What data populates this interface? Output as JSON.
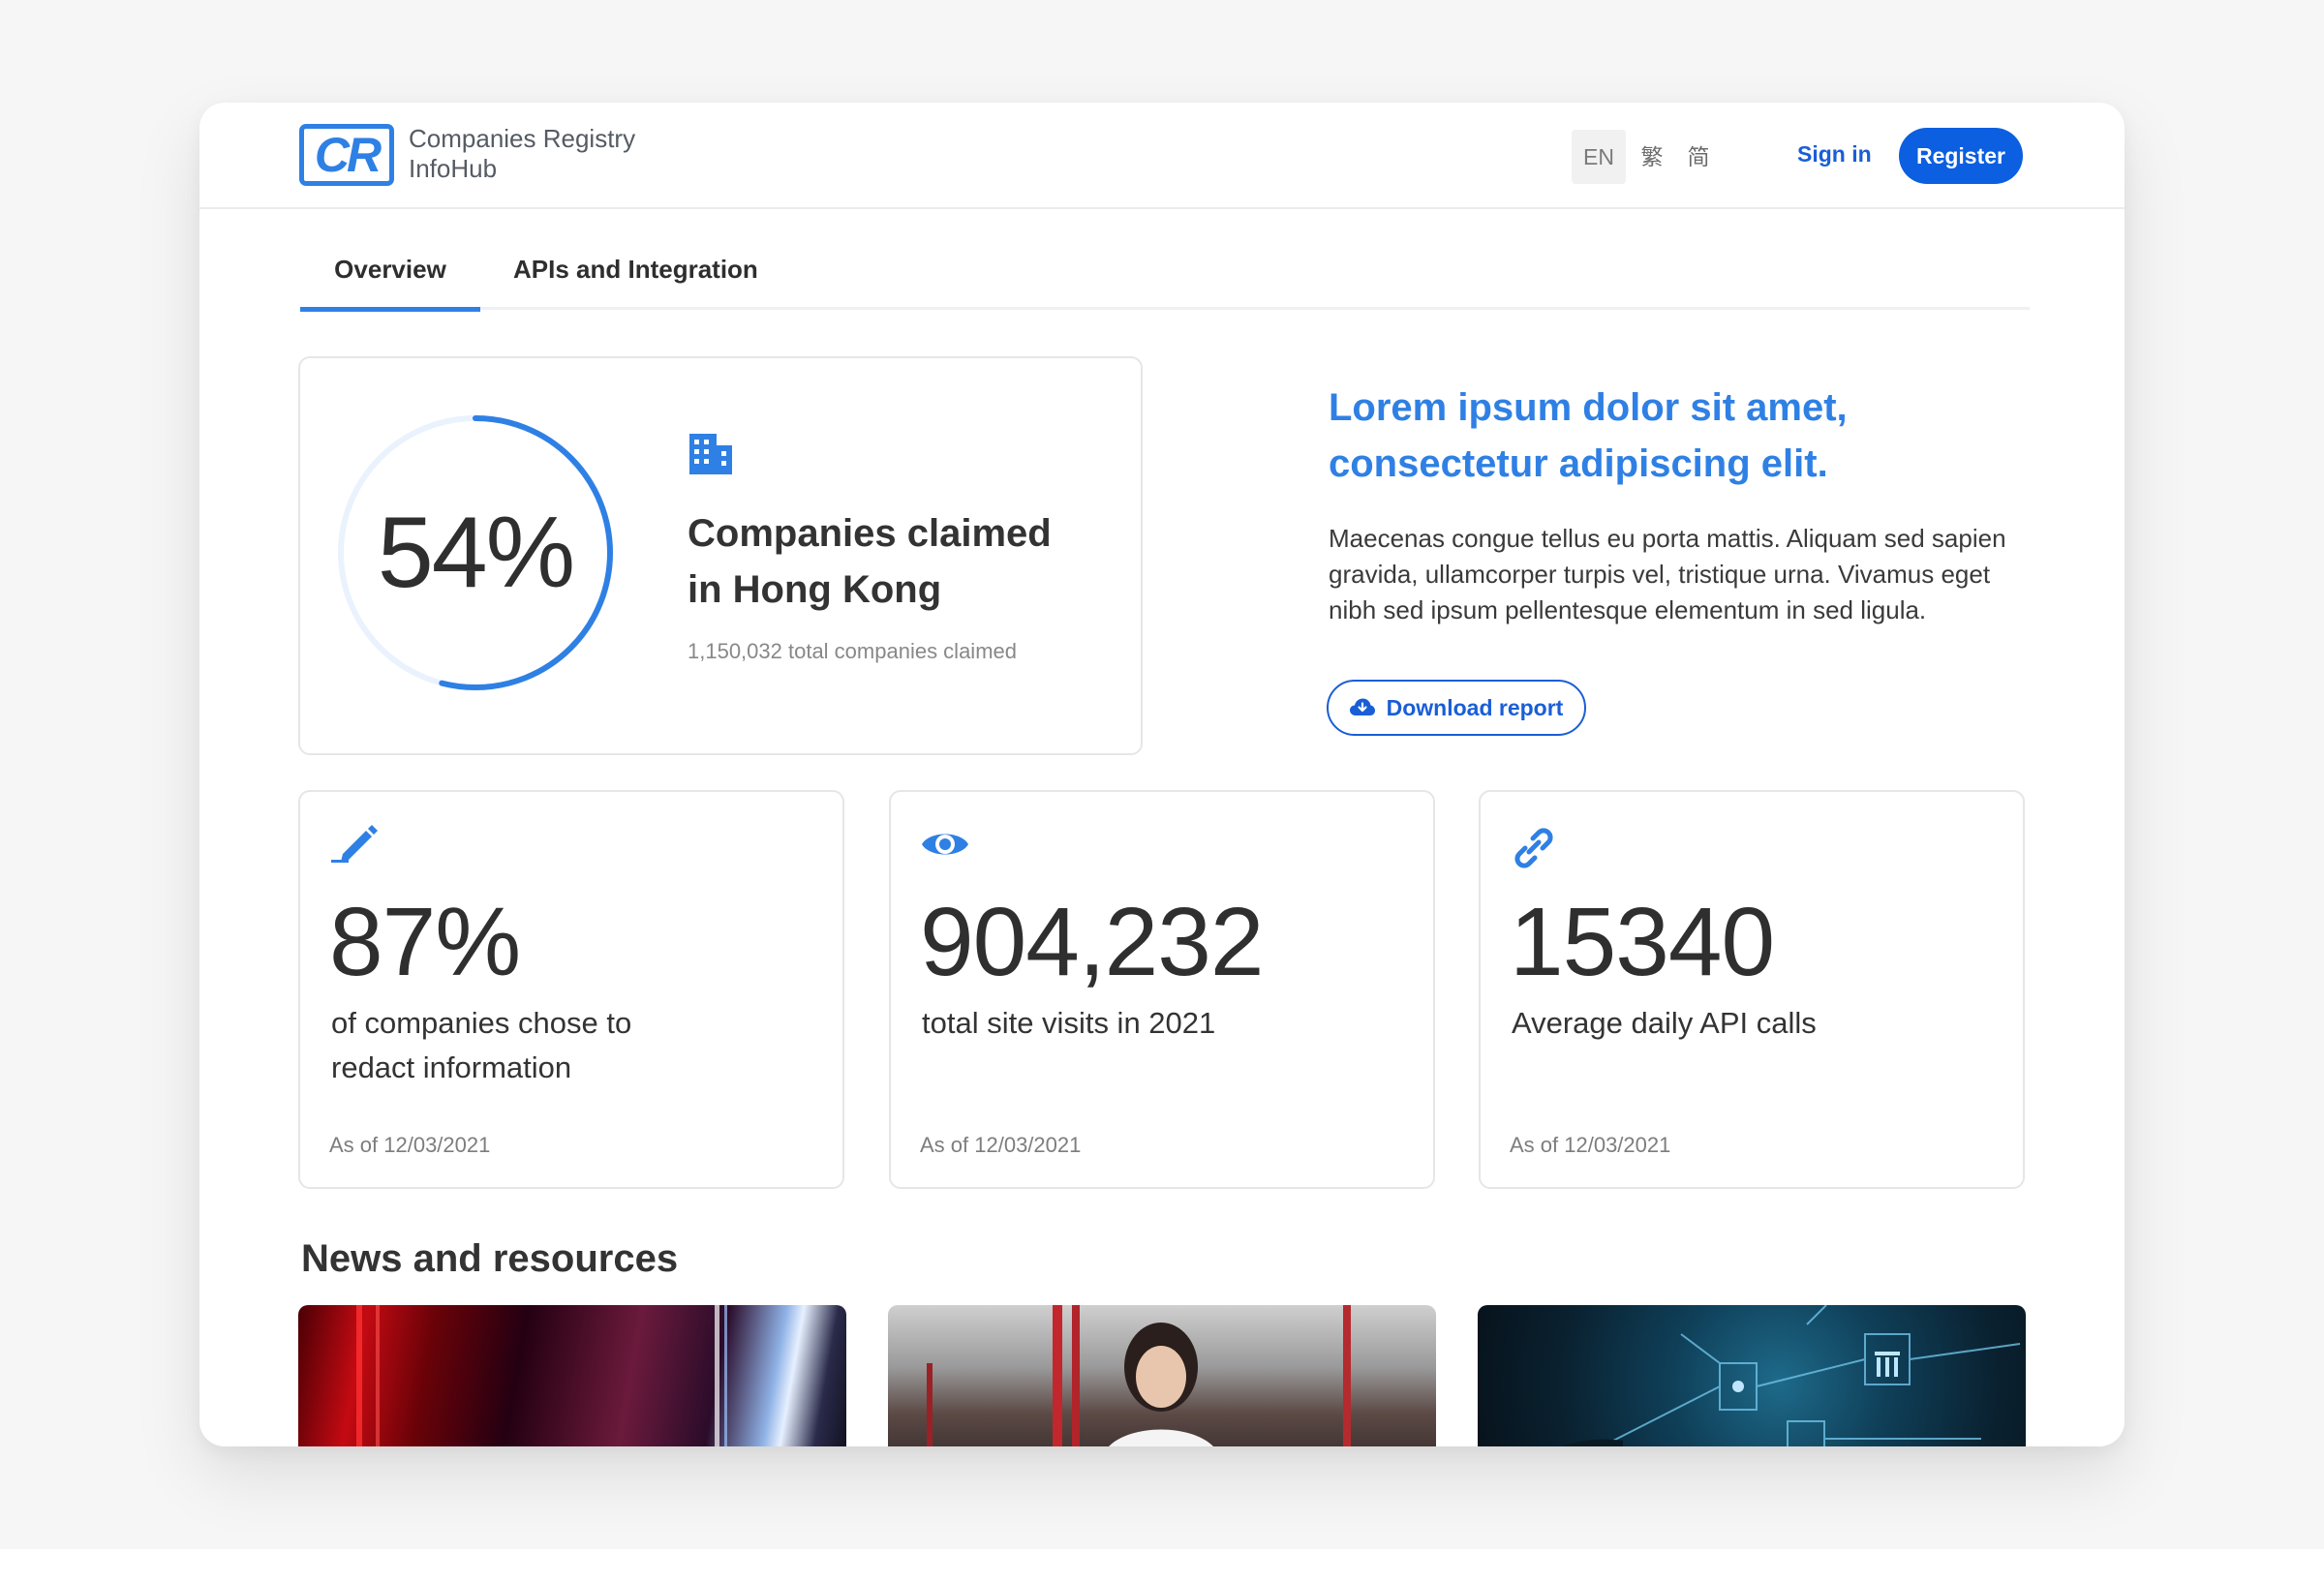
{
  "header": {
    "logo_letters": "CR",
    "logo_line1": "Companies Registry",
    "logo_line2": "InfoHub",
    "languages": [
      "EN",
      "繁",
      "简"
    ],
    "sign_in": "Sign in",
    "register": "Register"
  },
  "tabs": [
    {
      "label": "Overview",
      "active": true
    },
    {
      "label": "APIs and Integration",
      "active": false
    }
  ],
  "hero": {
    "percent_label": "54%",
    "percent_value": 0.54,
    "title": "Companies claimed in Hong Kong",
    "subtitle": "1,150,032 total companies claimed",
    "icon": "building-icon"
  },
  "promo": {
    "title": "Lorem ipsum dolor sit amet, consectetur adipiscing elit.",
    "body": "Maecenas congue tellus eu porta mattis. Aliquam sed sapien gravida, ullamcorper turpis vel, tristique urna. Vivamus eget nibh sed ipsum pellentesque elementum in sed ligula.",
    "download_label": "Download report"
  },
  "stats": [
    {
      "icon": "pen-icon",
      "value": "87%",
      "label": "of companies chose to redact information",
      "date": "As of 12/03/2021"
    },
    {
      "icon": "eye-icon",
      "value": "904,232",
      "label": "total site visits in 2021",
      "date": "As of 12/03/2021"
    },
    {
      "icon": "link-icon",
      "value": "15340",
      "label": "Average daily API calls",
      "date": "As of 12/03/2021"
    }
  ],
  "news": {
    "title": "News and resources"
  },
  "colors": {
    "accent": "#2f80e4",
    "primary_button": "#0b5fe0",
    "link": "#1a5ed6"
  }
}
